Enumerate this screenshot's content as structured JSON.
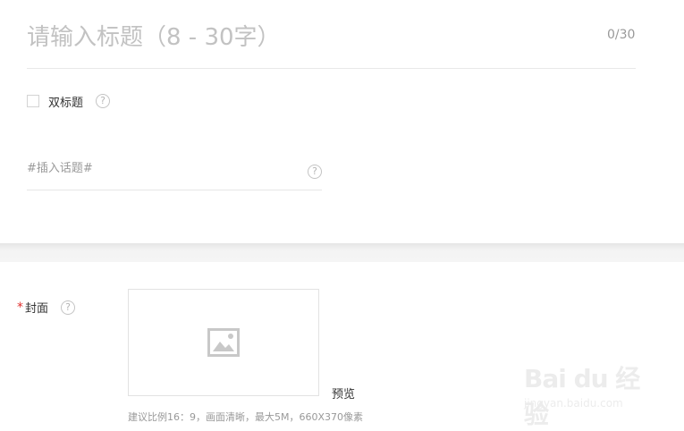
{
  "title_field": {
    "placeholder": "请输入标题（8 - 30字）",
    "counter": "0/30"
  },
  "dual_title": {
    "label": "双标题",
    "checked": false,
    "help": "?"
  },
  "topic_field": {
    "placeholder": "#插入话题#",
    "help": "?"
  },
  "cover": {
    "required_mark": "*",
    "label": "封面",
    "help": "?",
    "placeholder_icon": "image-icon",
    "preview_label": "预览",
    "hint": "建议比例16：9，画面清晰，最大5M，660X370像素"
  },
  "watermark": {
    "brand": "Bai du 经验",
    "domain": "jingyan.baidu.com"
  }
}
